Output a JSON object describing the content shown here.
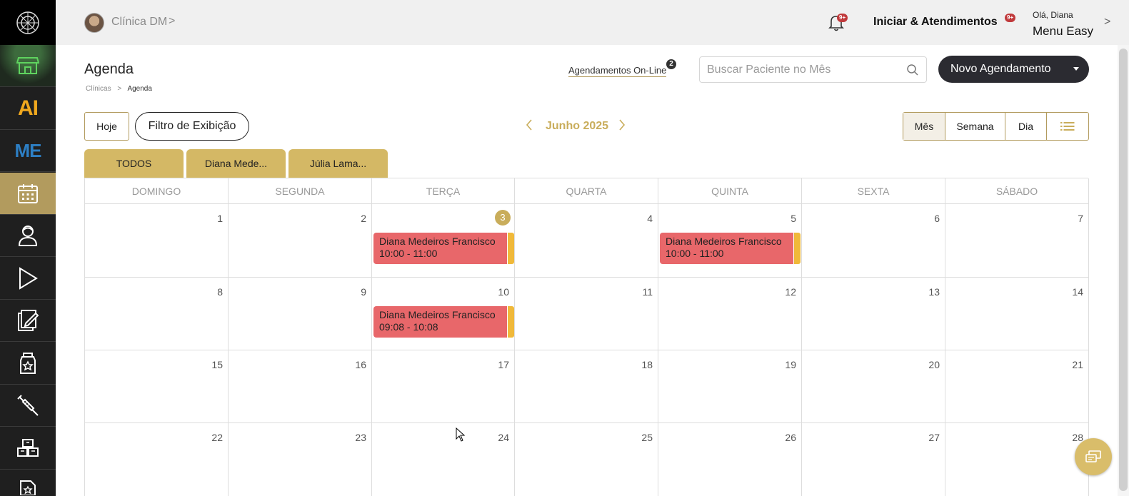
{
  "sidebar": {
    "items": [
      {
        "icon": "logo-icon"
      },
      {
        "icon": "store-icon"
      },
      {
        "icon": "ai-icon",
        "label": "AI"
      },
      {
        "icon": "me-icon",
        "label": "ME"
      },
      {
        "icon": "calendar-icon"
      },
      {
        "icon": "user-icon"
      },
      {
        "icon": "play-icon"
      },
      {
        "icon": "edit-document-icon"
      },
      {
        "icon": "medicine-bottle-icon"
      },
      {
        "icon": "syringe-icon"
      },
      {
        "icon": "boxes-icon"
      },
      {
        "icon": "document-star-icon"
      }
    ]
  },
  "topbar": {
    "clinic_name": "Clínica DM",
    "clinic_chevron": ">",
    "notifications_badge": "9+",
    "iniciar_label": "Iniciar & Atendimentos",
    "iniciar_badge": "9+",
    "greeting": "Olá, Diana",
    "menu_label": "Menu Easy",
    "menu_chevron": ">"
  },
  "header": {
    "title": "Agenda",
    "breadcrumb": {
      "parent": "Clínicas",
      "separator": ">",
      "current": "Agenda"
    },
    "online_link": "Agendamentos On-Line",
    "online_badge": "2",
    "search_placeholder": "Buscar Paciente no Mês",
    "new_button": "Novo Agendamento"
  },
  "toolbar": {
    "today_label": "Hoje",
    "filter_label": "Filtro de Exibição",
    "prev": "<",
    "month_label": "Junho 2025",
    "next": ">",
    "views": [
      "Mês",
      "Semana",
      "Dia"
    ],
    "active_view": "Mês"
  },
  "professional_tabs": [
    "TODOS",
    "Diana Mede...",
    "Júlia Lama..."
  ],
  "calendar": {
    "days_of_week": [
      "DOMINGO",
      "SEGUNDA",
      "TERÇA",
      "QUARTA",
      "QUINTA",
      "SEXTA",
      "SÁBADO"
    ],
    "today": 3,
    "weeks": [
      [
        1,
        2,
        3,
        4,
        5,
        6,
        7
      ],
      [
        8,
        9,
        10,
        11,
        12,
        13,
        14
      ],
      [
        15,
        16,
        17,
        18,
        19,
        20,
        21
      ],
      [
        22,
        23,
        24,
        25,
        26,
        27,
        28
      ]
    ],
    "events": [
      {
        "day": 3,
        "patient": "Diana Medeiros Francisco",
        "time": "10:00 - 11:00",
        "color": "#e8676a",
        "tag_color": "#f0b93a"
      },
      {
        "day": 5,
        "patient": "Diana Medeiros Francisco",
        "time": "10:00 - 11:00",
        "color": "#e8676a",
        "tag_color": "#f0b93a"
      },
      {
        "day": 10,
        "patient": "Diana Medeiros Francisco",
        "time": "09:08 - 10:08",
        "color": "#e8676a",
        "tag_color": "#f0b93a"
      }
    ]
  },
  "colors": {
    "accent": "#b29b5e",
    "gold": "#c9ad5b",
    "dark_button": "#2b2b31"
  }
}
